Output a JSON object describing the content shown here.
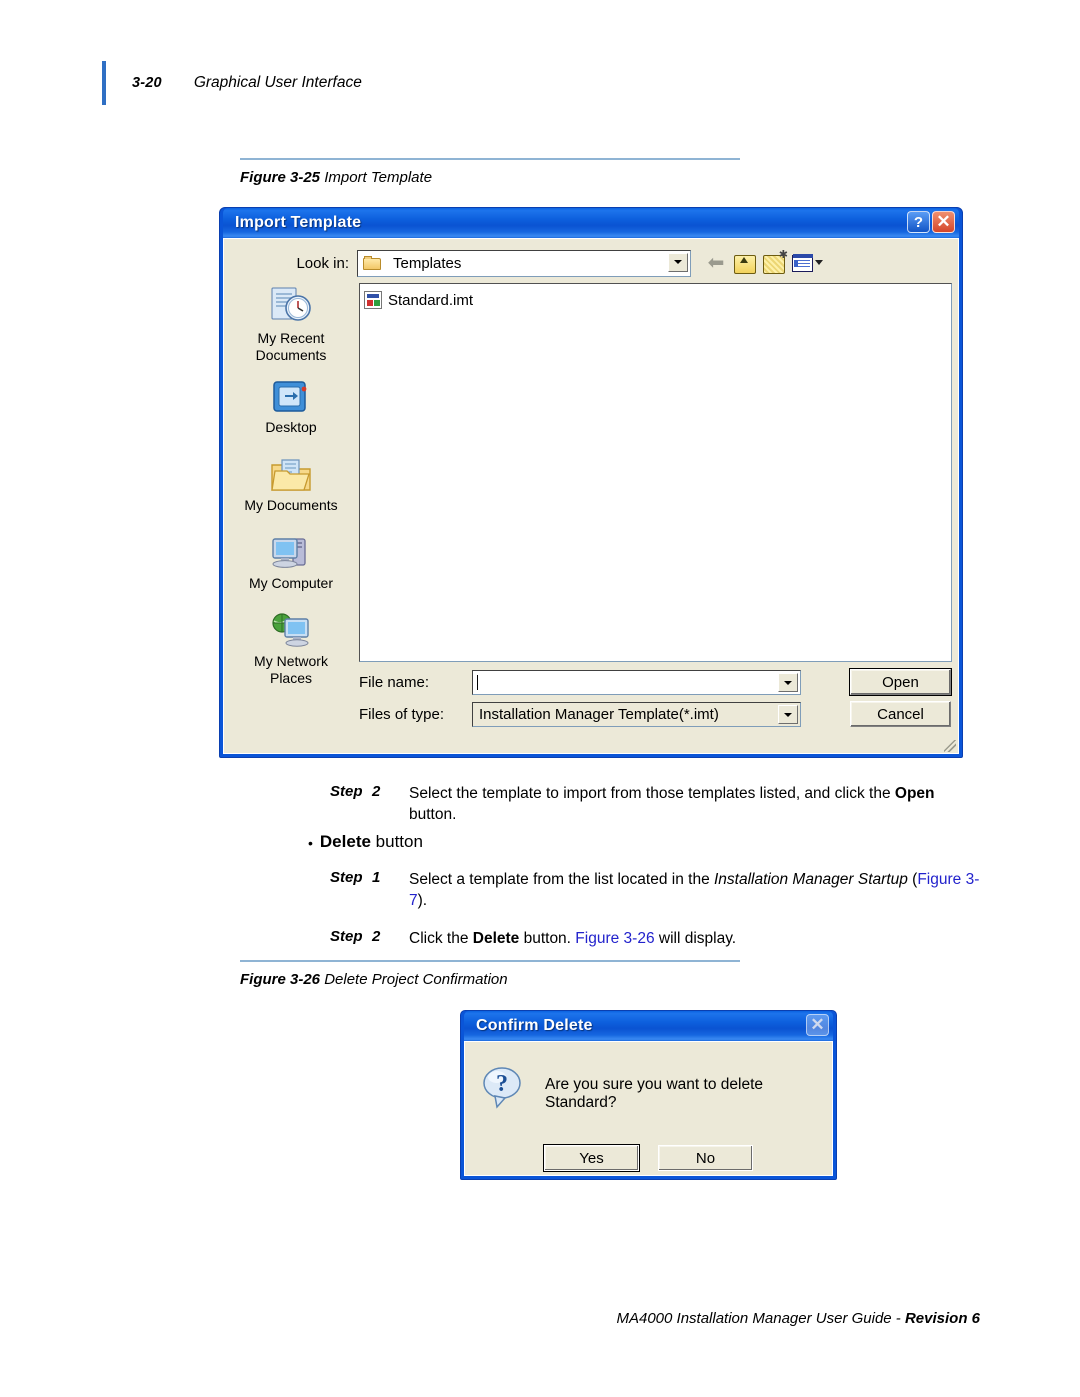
{
  "header": {
    "page_number": "3-20",
    "section_title": "Graphical User Interface"
  },
  "figures": [
    {
      "number": "Figure 3-25",
      "title": "Import Template"
    },
    {
      "number": "Figure 3-26",
      "title": "Delete Project Confirmation"
    }
  ],
  "import_dialog": {
    "title": "Import Template",
    "help_button": "?",
    "close_button": "✕",
    "lookin_label": "Look in:",
    "lookin_value": "Templates",
    "toolbar": {
      "back": "back-icon",
      "up_one_level": "up-one-level-icon",
      "new_folder": "new-folder-icon",
      "views": "views-icon"
    },
    "places": [
      {
        "label": "My Recent\nDocuments",
        "icon": "recent-documents-icon"
      },
      {
        "label": "Desktop",
        "icon": "desktop-icon"
      },
      {
        "label": "My Documents",
        "icon": "my-documents-icon"
      },
      {
        "label": "My Computer",
        "icon": "my-computer-icon"
      },
      {
        "label": "My Network\nPlaces",
        "icon": "my-network-places-icon"
      }
    ],
    "files": [
      {
        "name": "Standard.imt",
        "icon": "imt-file-icon"
      }
    ],
    "filename_label": "File name:",
    "filename_value": "",
    "filetype_label": "Files of type:",
    "filetype_value": "Installation Manager Template(*.imt)",
    "open_button": "Open",
    "cancel_button": "Cancel"
  },
  "steps_after_import": [
    {
      "word": "Step",
      "number": "2",
      "parts": [
        {
          "t": "Select the template to import from those templates listed, and click the ",
          "style": "normal"
        },
        {
          "t": "Open",
          "style": "bold"
        },
        {
          "t": " button.",
          "style": "normal"
        }
      ]
    }
  ],
  "delete_bullet": {
    "bullet": "•",
    "bold_word": "Delete",
    "rest": " button"
  },
  "steps_delete": [
    {
      "word": "Step",
      "number": "1",
      "parts": [
        {
          "t": "Select a template from the list located in the ",
          "style": "normal"
        },
        {
          "t": "Installation Manager Startup",
          "style": "italic"
        },
        {
          "t": " (",
          "style": "normal"
        },
        {
          "t": "Figure 3-7",
          "style": "link"
        },
        {
          "t": ").",
          "style": "normal"
        }
      ]
    },
    {
      "word": "Step",
      "number": "2",
      "parts": [
        {
          "t": "Click the ",
          "style": "normal"
        },
        {
          "t": "Delete",
          "style": "bold"
        },
        {
          "t": " button. ",
          "style": "normal"
        },
        {
          "t": "Figure 3-26",
          "style": "link"
        },
        {
          "t": " will display.",
          "style": "normal"
        }
      ]
    }
  ],
  "confirm_dialog": {
    "title": "Confirm Delete",
    "close_button": "✕",
    "icon": "question-balloon-icon",
    "message": "Are you sure you want to delete Standard?",
    "yes_button": "Yes",
    "no_button": "No"
  },
  "footer": {
    "text_plain": "MA4000 Installation Manager User Guide - ",
    "text_bold": "Revision  6"
  },
  "colors": {
    "accent_blue": "#2f6fc4",
    "title_bar_blue": "#0a55d8",
    "dialog_face": "#ece9d8",
    "figure_rule": "#8fb4d4",
    "link": "#2222cc"
  }
}
